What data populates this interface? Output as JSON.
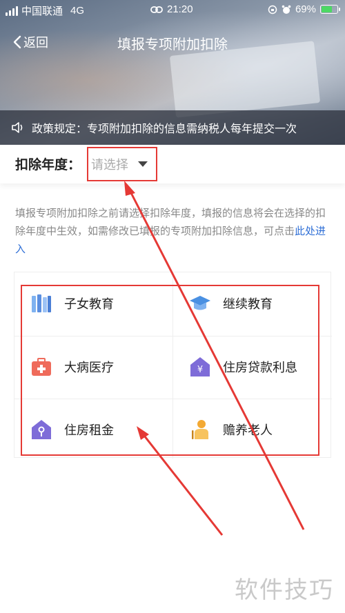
{
  "status_bar": {
    "carrier": "中国联通",
    "network": "4G",
    "time": "21:20",
    "battery": "69%",
    "battery_level": 0.69
  },
  "nav": {
    "back_label": "返回",
    "title": "填报专项附加扣除"
  },
  "notice": {
    "text": "政策规定：专项附加扣除的信息需纳税人每年提交一次"
  },
  "year_selector": {
    "label": "扣除年度：",
    "placeholder": "请选择"
  },
  "description": {
    "text": "填报专项附加扣除之前请选择扣除年度，填报的信息将会在选择的扣除年度中生效，如需修改已填报的专项附加扣除信息，可点击",
    "link": "此处进入"
  },
  "categories": [
    {
      "label": "子女教育",
      "icon": "books-icon",
      "color": "#5b8fe0"
    },
    {
      "label": "继续教育",
      "icon": "graduation-cap-icon",
      "color": "#4a90e2"
    },
    {
      "label": "大病医疗",
      "icon": "medical-kit-icon",
      "color": "#ef6b5b"
    },
    {
      "label": "住房贷款利息",
      "icon": "house-yuan-icon",
      "color": "#7e6cd8"
    },
    {
      "label": "住房租金",
      "icon": "house-key-icon",
      "color": "#7e6cd8"
    },
    {
      "label": "赡养老人",
      "icon": "elderly-icon",
      "color": "#f3a933"
    }
  ],
  "watermark": "软件技巧",
  "colors": {
    "annotation": "#e53935",
    "link": "#2f6fd6"
  }
}
